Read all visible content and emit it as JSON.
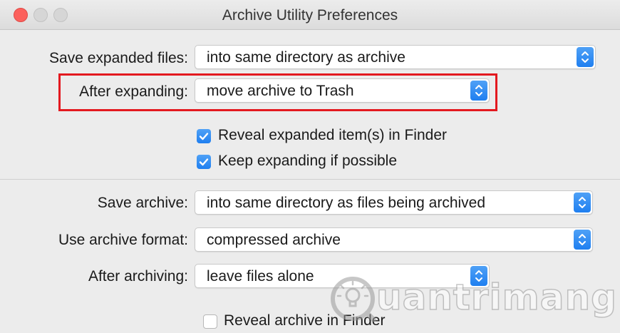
{
  "window": {
    "title": "Archive Utility Preferences"
  },
  "expand": {
    "save_expanded": {
      "label": "Save expanded files:",
      "value": "into same directory as archive"
    },
    "after_expanding": {
      "label": "After expanding:",
      "value": "move archive to Trash"
    },
    "reveal_expanded": {
      "label": "Reveal expanded item(s) in Finder",
      "checked": true
    },
    "keep_expanding": {
      "label": "Keep expanding if possible",
      "checked": true
    }
  },
  "archive": {
    "save_archive": {
      "label": "Save archive:",
      "value": "into same directory as files being archived"
    },
    "format": {
      "label": "Use archive format:",
      "value": "compressed archive"
    },
    "after_archiving": {
      "label": "After archiving:",
      "value": "leave files alone"
    },
    "reveal_archive": {
      "label": "Reveal archive in Finder",
      "checked": false
    }
  },
  "watermark": {
    "text": "uantrimang"
  },
  "colors": {
    "accent": "#1f7ff0",
    "highlight": "#e3191f",
    "close": "#fc605c"
  },
  "icons": {
    "popup": "updown-chevron-icon",
    "check": "checkmark-icon",
    "watermark": "lightbulb-icon"
  }
}
